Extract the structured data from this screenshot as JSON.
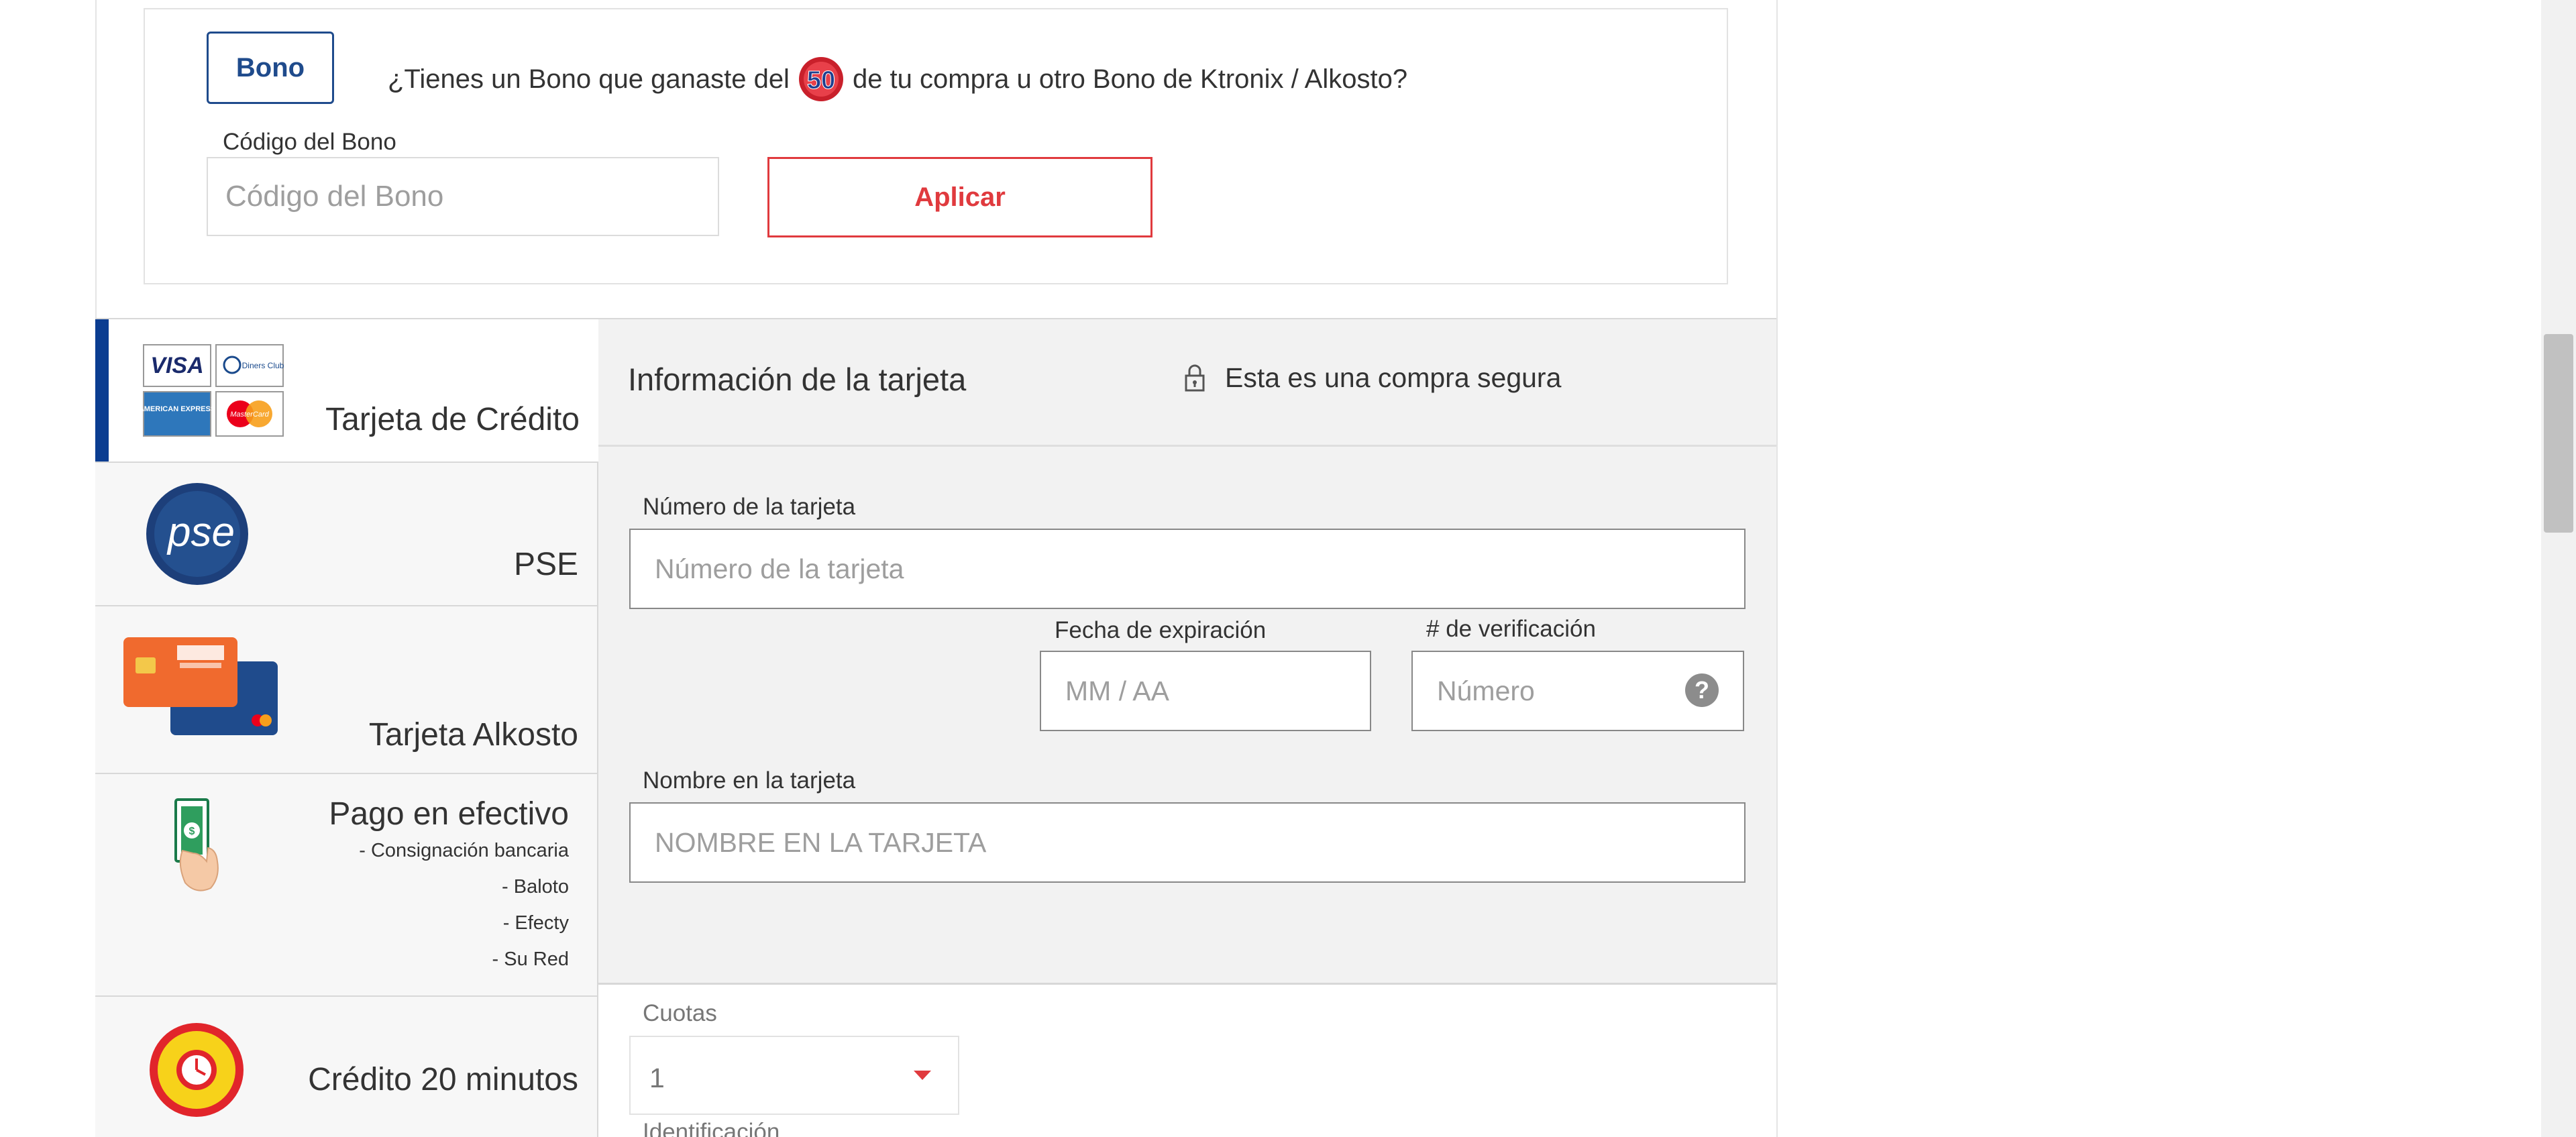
{
  "bono": {
    "badge_label": "Bono",
    "question_before": "¿Tienes un Bono que ganaste del",
    "question_badge": "50",
    "question_after": "de tu compra u otro Bono de Ktronix / Alkosto?",
    "code_label": "Código del Bono",
    "code_placeholder": "Código del Bono",
    "apply_label": "Aplicar"
  },
  "payment_methods": [
    {
      "label": "Tarjeta de Crédito",
      "active": true,
      "icon": "card-brands-icon",
      "sub": []
    },
    {
      "label": "PSE",
      "active": false,
      "icon": "pse-icon",
      "sub": []
    },
    {
      "label": "Tarjeta Alkosto",
      "active": false,
      "icon": "alkosto-card-icon",
      "sub": []
    },
    {
      "label": "Pago en efectivo",
      "active": false,
      "icon": "cash-payment-icon",
      "sub": [
        "- Consignación bancaria",
        "- Baloto",
        "- Efecty",
        "- Su Red"
      ]
    },
    {
      "label": "Crédito 20 minutos",
      "active": false,
      "icon": "credito-20-minutos-icon",
      "sub": []
    }
  ],
  "card_brands": [
    "VISA",
    "Diners Club",
    "AMERICAN EXPRESS",
    "MasterCard"
  ],
  "card_info": {
    "title": "Información de la tarjeta",
    "secure_text": "Esta es una compra segura",
    "number_label": "Número de la tarjeta",
    "number_placeholder": "Número de la tarjeta",
    "expiry_label": "Fecha de expiración",
    "expiry_placeholder": "MM / AA",
    "cvv_label": "# de verificación",
    "cvv_placeholder": "Número",
    "cvv_help": "?",
    "name_label": "Nombre en la tarjeta",
    "name_placeholder": "NOMBRE EN LA TARJETA"
  },
  "cuotas": {
    "label": "Cuotas",
    "value": "1"
  },
  "identificacion": {
    "label": "Identificación"
  },
  "colors": {
    "accent_blue": "#0b3d91",
    "accent_red": "#e03a3e"
  }
}
